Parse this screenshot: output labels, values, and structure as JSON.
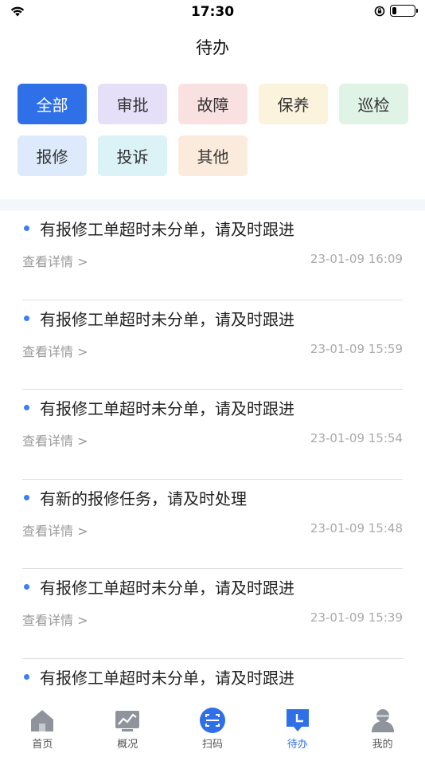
{
  "status_bar": {
    "time": "17:30",
    "battery_level": 0.2
  },
  "header": {
    "title": "待办"
  },
  "filters": [
    {
      "label": "全部",
      "bg": "#2f6fe8",
      "fg": "#ffffff",
      "active": true
    },
    {
      "label": "审批",
      "bg": "#e5e0f8",
      "fg": "#333333"
    },
    {
      "label": "故障",
      "bg": "#f8e1e0",
      "fg": "#333333"
    },
    {
      "label": "保养",
      "bg": "#fbf3dc",
      "fg": "#333333"
    },
    {
      "label": "巡检",
      "bg": "#dff3e6",
      "fg": "#333333"
    },
    {
      "label": "报修",
      "bg": "#dceafb",
      "fg": "#333333"
    },
    {
      "label": "投诉",
      "bg": "#dbf2f6",
      "fg": "#333333"
    },
    {
      "label": "其他",
      "bg": "#fbebdc",
      "fg": "#333333"
    }
  ],
  "list": {
    "items": [
      {
        "title": "有报修工单超时未分单，请及时跟进",
        "detail": "查看详情 >",
        "time": "23-01-09 16:09"
      },
      {
        "title": "有报修工单超时未分单，请及时跟进",
        "detail": "查看详情 >",
        "time": "23-01-09 15:59"
      },
      {
        "title": "有报修工单超时未分单，请及时跟进",
        "detail": "查看详情 >",
        "time": "23-01-09 15:54"
      },
      {
        "title": "有新的报修任务，请及时处理",
        "detail": "查看详情 >",
        "time": "23-01-09 15:48"
      },
      {
        "title": "有报修工单超时未分单，请及时跟进",
        "detail": "查看详情 >",
        "time": "23-01-09 15:39"
      },
      {
        "title": "有报修工单超时未分单，请及时跟进",
        "detail": "",
        "time": ""
      }
    ]
  },
  "tabbar": {
    "tabs": [
      {
        "label": "首页",
        "icon": "home-icon"
      },
      {
        "label": "概况",
        "icon": "chart-icon"
      },
      {
        "label": "扫码",
        "icon": "scan-icon"
      },
      {
        "label": "待办",
        "icon": "todo-icon",
        "active": true
      },
      {
        "label": "我的",
        "icon": "profile-icon"
      }
    ]
  },
  "colors": {
    "accent": "#2f6fe8",
    "dot": "#3d7ff2"
  }
}
